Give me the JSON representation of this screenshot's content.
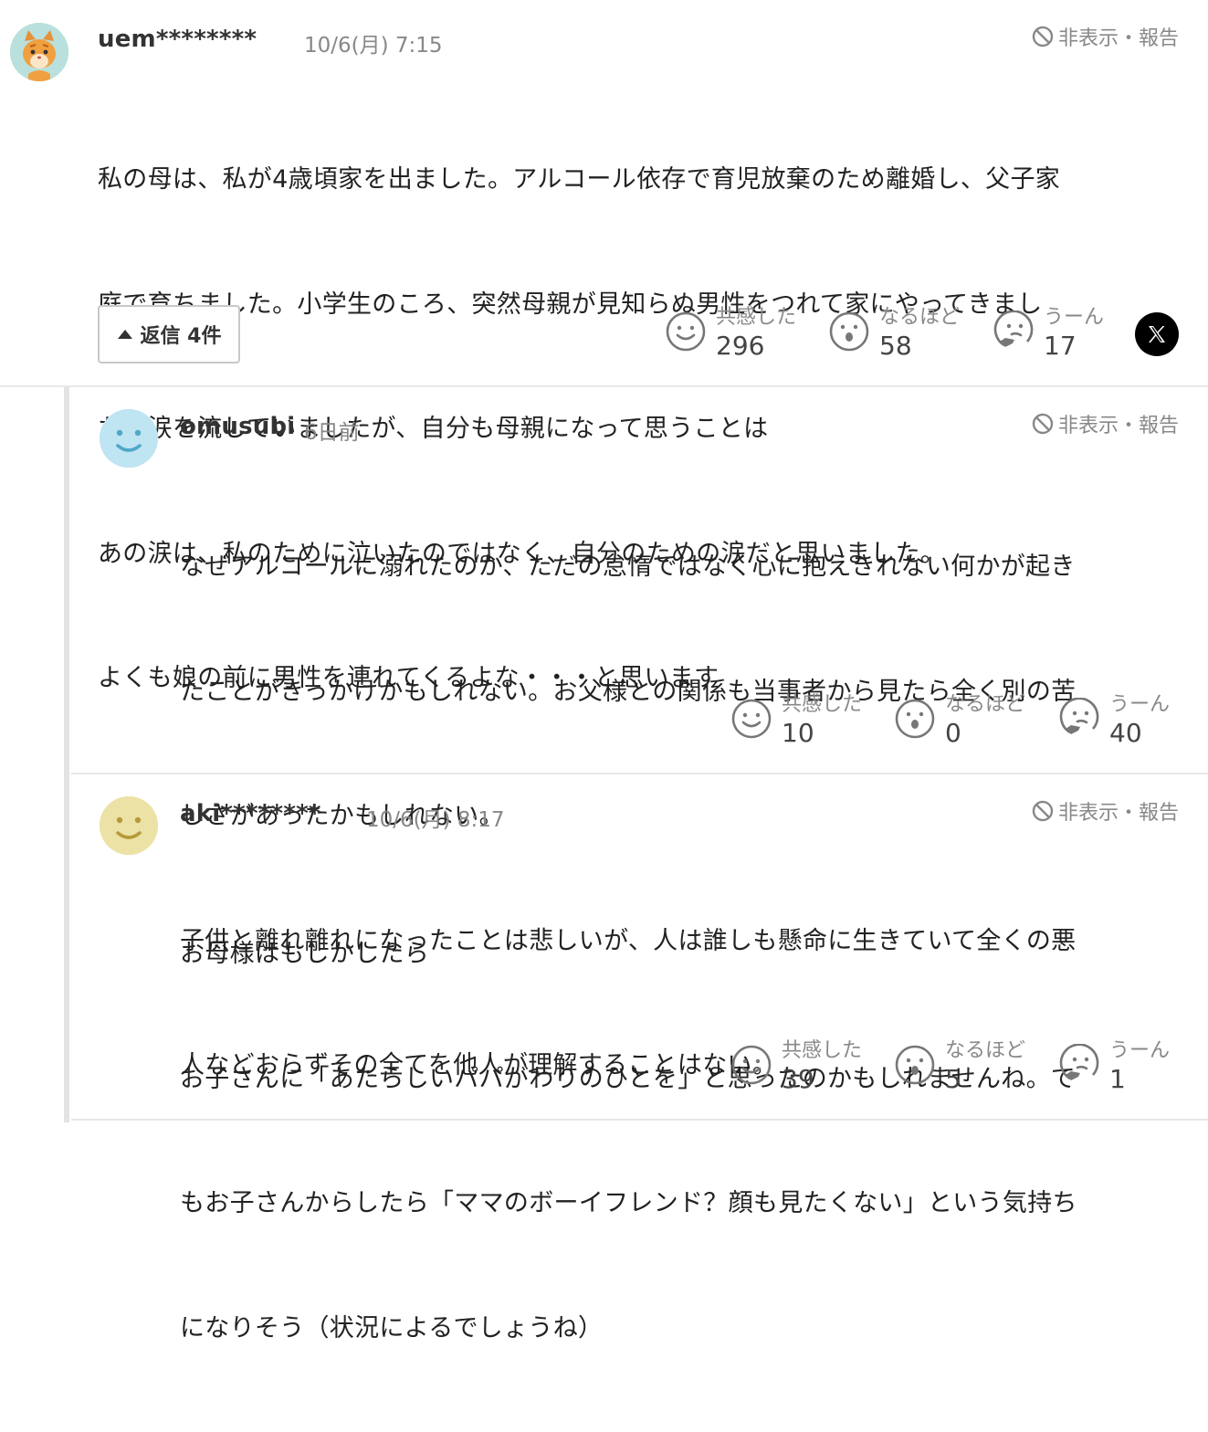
{
  "hide_report_label": "非表示・報告",
  "comments": [
    {
      "username": "uem********",
      "timestamp": "10/6(月) 7:15",
      "lines": [
        "私の母は、私が4歳頃家を出ました。アルコール依存で育児放棄のため離婚し、父子家",
        "庭で育ちました。小学生のころ、突然母親が見知らぬ男性をつれて家にやってきまし",
        "た。涙を流していましたが、自分も母親になって思うことは",
        "あの涙は、私のために泣いたのではなく、自分のための涙だと思いました。",
        "よくも娘の前に男性を連れてくるよな・・・と思います"
      ],
      "replies_button": "返信 4件",
      "reactions": [
        {
          "label": "共感した",
          "count": "296"
        },
        {
          "label": "なるほど",
          "count": "58"
        },
        {
          "label": "うーん",
          "count": "17"
        }
      ]
    },
    {
      "username": "omusubi",
      "timestamp": "6日前",
      "lines": [
        "なぜアルコールに溺れたのか、ただの怠惰ではなく心に抱えきれない何かが起き",
        "たことがきっかけかもしれない。お父様との関係も当事者から見たら全く別の苦",
        "しさがあったかもしれない。",
        "子供と離れ離れになったことは悲しいが、人は誰しも懸命に生きていて全くの悪",
        "人などおらずその全てを他人が理解することはない。"
      ],
      "reactions": [
        {
          "label": "共感した",
          "count": "10"
        },
        {
          "label": "なるほど",
          "count": "0"
        },
        {
          "label": "うーん",
          "count": "40"
        }
      ]
    },
    {
      "username": "aki********",
      "timestamp": "10/6(月) 8:17",
      "lines": [
        "お母様はもしかしたら",
        "お子さんに「あたらしいパパがわりのひとを」と思ったのかもしれませんね。で",
        "もお子さんからしたら「ママのボーイフレンド？顔も見たくない」という気持ち",
        "になりそう（状況によるでしょうね）"
      ],
      "reactions": [
        {
          "label": "共感した",
          "count": "39"
        },
        {
          "label": "なるほど",
          "count": "5"
        },
        {
          "label": "うーん",
          "count": "1"
        }
      ]
    }
  ]
}
